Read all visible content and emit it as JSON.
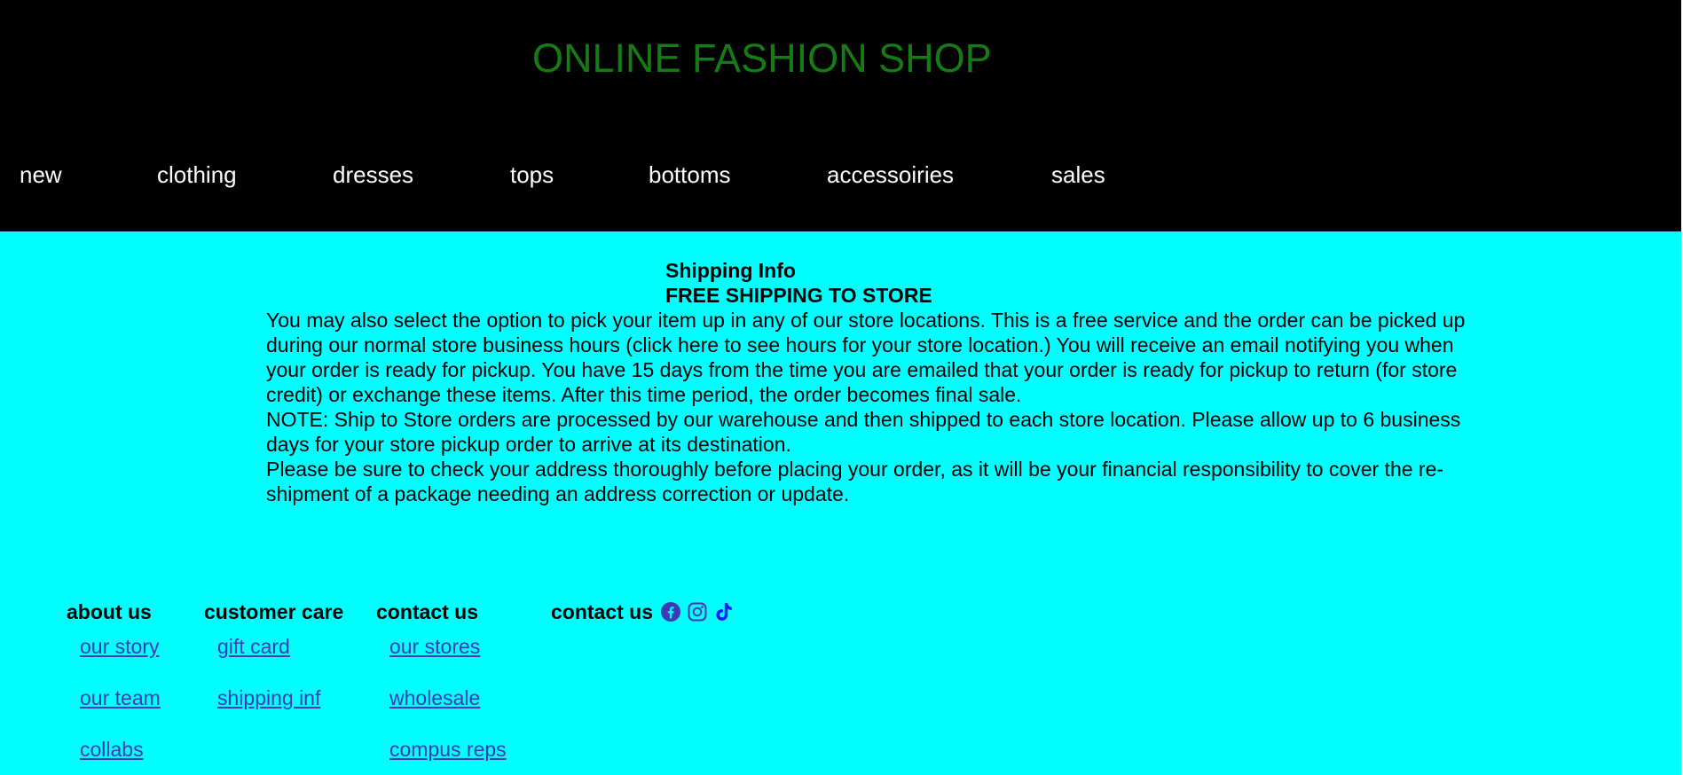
{
  "header": {
    "title": "ONLINE FASHION SHOP",
    "nav": [
      "new",
      "clothing",
      "dresses",
      "tops",
      "bottoms",
      "accessoiries",
      "sales"
    ]
  },
  "main": {
    "heading1": "Shipping Info",
    "heading2": "FREE SHIPPING TO STORE",
    "paragraphs": [
      "You may also select the option to pick your item up in any of our store locations. This is a free service and the order can be picked up during our normal store business hours (click here to see hours for your store location.) You will receive an email notifying you when your order is ready for pickup. You have 15 days from the time you are emailed that your order is ready for pickup to return (for store credit) or exchange these items. After this time period, the order becomes final sale.",
      "NOTE: Ship to Store orders are processed by our warehouse and then shipped to each store location. Please allow up to 6 business days for your store pickup order to arrive at its destination.",
      "Please be sure to check your address thoroughly before placing your order, as it will be your financial responsibility to cover the re-shipment of a package needing an address correction or update."
    ]
  },
  "footer": {
    "about": {
      "heading": "about us",
      "links": [
        "our story",
        "our team",
        "collabs"
      ]
    },
    "care": {
      "heading": "customer care",
      "links": [
        "gift card",
        "shipping inf"
      ]
    },
    "contact": {
      "heading": "contact us",
      "links": [
        "our stores",
        "wholesale",
        "compus reps"
      ]
    },
    "social": {
      "heading": "contact us",
      "icons": [
        "facebook-icon",
        "instagram-icon",
        "tiktok-icon"
      ]
    }
  },
  "colors": {
    "header_bg": "#000000",
    "title": "#167a16",
    "page_bg": "#00ffff",
    "link": "#3b3bb5",
    "icon": "#3b3bb5"
  }
}
